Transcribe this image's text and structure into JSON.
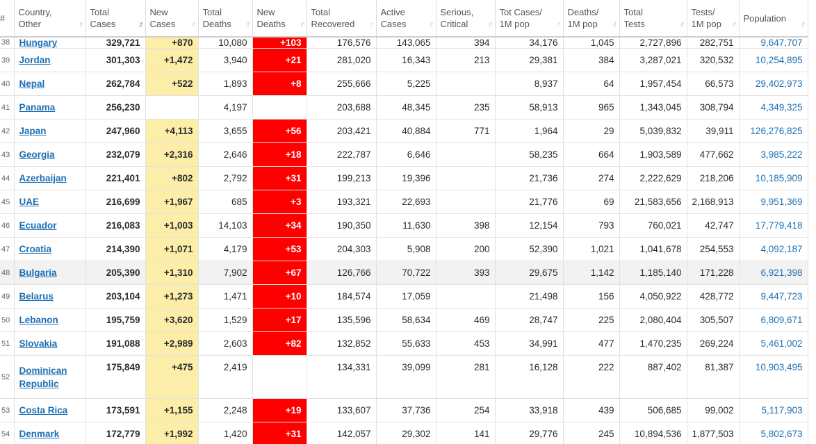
{
  "headers": [
    {
      "label": "#"
    },
    {
      "label": "Country,\nOther"
    },
    {
      "label": "Total\nCases",
      "sorted": true
    },
    {
      "label": "New\nCases"
    },
    {
      "label": "Total\nDeaths"
    },
    {
      "label": "New\nDeaths"
    },
    {
      "label": "Total\nRecovered"
    },
    {
      "label": "Active\nCases"
    },
    {
      "label": "Serious,\nCritical"
    },
    {
      "label": "Tot Cases/\n1M pop"
    },
    {
      "label": "Deaths/\n1M pop"
    },
    {
      "label": "Total\nTests"
    },
    {
      "label": "Tests/\n1M pop"
    },
    {
      "label": "Population"
    }
  ],
  "rows": [
    {
      "num": "38",
      "country": "Hungary",
      "total_cases": "329,721",
      "new_cases": "+870",
      "total_deaths": "10,080",
      "new_deaths": "+103",
      "total_recovered": "176,576",
      "active_cases": "143,065",
      "serious_critical": "394",
      "cases_per_1m": "34,176",
      "deaths_per_1m": "1,045",
      "total_tests": "2,727,896",
      "tests_per_1m": "282,751",
      "population": "9,647,707"
    },
    {
      "num": "39",
      "country": "Jordan",
      "total_cases": "301,303",
      "new_cases": "+1,472",
      "total_deaths": "3,940",
      "new_deaths": "+21",
      "total_recovered": "281,020",
      "active_cases": "16,343",
      "serious_critical": "213",
      "cases_per_1m": "29,381",
      "deaths_per_1m": "384",
      "total_tests": "3,287,021",
      "tests_per_1m": "320,532",
      "population": "10,254,895"
    },
    {
      "num": "40",
      "country": "Nepal",
      "total_cases": "262,784",
      "new_cases": "+522",
      "total_deaths": "1,893",
      "new_deaths": "+8",
      "total_recovered": "255,666",
      "active_cases": "5,225",
      "serious_critical": "",
      "cases_per_1m": "8,937",
      "deaths_per_1m": "64",
      "total_tests": "1,957,454",
      "tests_per_1m": "66,573",
      "population": "29,402,973"
    },
    {
      "num": "41",
      "country": "Panama",
      "total_cases": "256,230",
      "new_cases": "",
      "total_deaths": "4,197",
      "new_deaths": "",
      "total_recovered": "203,688",
      "active_cases": "48,345",
      "serious_critical": "235",
      "cases_per_1m": "58,913",
      "deaths_per_1m": "965",
      "total_tests": "1,343,045",
      "tests_per_1m": "308,794",
      "population": "4,349,325"
    },
    {
      "num": "42",
      "country": "Japan",
      "total_cases": "247,960",
      "new_cases": "+4,113",
      "total_deaths": "3,655",
      "new_deaths": "+56",
      "total_recovered": "203,421",
      "active_cases": "40,884",
      "serious_critical": "771",
      "cases_per_1m": "1,964",
      "deaths_per_1m": "29",
      "total_tests": "5,039,832",
      "tests_per_1m": "39,911",
      "population": "126,276,825"
    },
    {
      "num": "43",
      "country": "Georgia",
      "total_cases": "232,079",
      "new_cases": "+2,316",
      "total_deaths": "2,646",
      "new_deaths": "+18",
      "total_recovered": "222,787",
      "active_cases": "6,646",
      "serious_critical": "",
      "cases_per_1m": "58,235",
      "deaths_per_1m": "664",
      "total_tests": "1,903,589",
      "tests_per_1m": "477,662",
      "population": "3,985,222"
    },
    {
      "num": "44",
      "country": "Azerbaijan",
      "total_cases": "221,401",
      "new_cases": "+802",
      "total_deaths": "2,792",
      "new_deaths": "+31",
      "total_recovered": "199,213",
      "active_cases": "19,396",
      "serious_critical": "",
      "cases_per_1m": "21,736",
      "deaths_per_1m": "274",
      "total_tests": "2,222,629",
      "tests_per_1m": "218,206",
      "population": "10,185,909"
    },
    {
      "num": "45",
      "country": "UAE",
      "total_cases": "216,699",
      "new_cases": "+1,967",
      "total_deaths": "685",
      "new_deaths": "+3",
      "total_recovered": "193,321",
      "active_cases": "22,693",
      "serious_critical": "",
      "cases_per_1m": "21,776",
      "deaths_per_1m": "69",
      "total_tests": "21,583,656",
      "tests_per_1m": "2,168,913",
      "population": "9,951,369"
    },
    {
      "num": "46",
      "country": "Ecuador",
      "total_cases": "216,083",
      "new_cases": "+1,003",
      "total_deaths": "14,103",
      "new_deaths": "+34",
      "total_recovered": "190,350",
      "active_cases": "11,630",
      "serious_critical": "398",
      "cases_per_1m": "12,154",
      "deaths_per_1m": "793",
      "total_tests": "760,021",
      "tests_per_1m": "42,747",
      "population": "17,779,418"
    },
    {
      "num": "47",
      "country": "Croatia",
      "total_cases": "214,390",
      "new_cases": "+1,071",
      "total_deaths": "4,179",
      "new_deaths": "+53",
      "total_recovered": "204,303",
      "active_cases": "5,908",
      "serious_critical": "200",
      "cases_per_1m": "52,390",
      "deaths_per_1m": "1,021",
      "total_tests": "1,041,678",
      "tests_per_1m": "254,553",
      "population": "4,092,187"
    },
    {
      "num": "48",
      "country": "Bulgaria",
      "total_cases": "205,390",
      "new_cases": "+1,310",
      "total_deaths": "7,902",
      "new_deaths": "+67",
      "total_recovered": "126,766",
      "active_cases": "70,722",
      "serious_critical": "393",
      "cases_per_1m": "29,675",
      "deaths_per_1m": "1,142",
      "total_tests": "1,185,140",
      "tests_per_1m": "171,228",
      "population": "6,921,398",
      "highlighted": true
    },
    {
      "num": "49",
      "country": "Belarus",
      "total_cases": "203,104",
      "new_cases": "+1,273",
      "total_deaths": "1,471",
      "new_deaths": "+10",
      "total_recovered": "184,574",
      "active_cases": "17,059",
      "serious_critical": "",
      "cases_per_1m": "21,498",
      "deaths_per_1m": "156",
      "total_tests": "4,050,922",
      "tests_per_1m": "428,772",
      "population": "9,447,723"
    },
    {
      "num": "50",
      "country": "Lebanon",
      "total_cases": "195,759",
      "new_cases": "+3,620",
      "total_deaths": "1,529",
      "new_deaths": "+17",
      "total_recovered": "135,596",
      "active_cases": "58,634",
      "serious_critical": "469",
      "cases_per_1m": "28,747",
      "deaths_per_1m": "225",
      "total_tests": "2,080,404",
      "tests_per_1m": "305,507",
      "population": "6,809,671"
    },
    {
      "num": "51",
      "country": "Slovakia",
      "total_cases": "191,088",
      "new_cases": "+2,989",
      "total_deaths": "2,603",
      "new_deaths": "+82",
      "total_recovered": "132,852",
      "active_cases": "55,633",
      "serious_critical": "453",
      "cases_per_1m": "34,991",
      "deaths_per_1m": "477",
      "total_tests": "1,470,235",
      "tests_per_1m": "269,224",
      "population": "5,461,002"
    },
    {
      "num": "52",
      "country": "Dominican Republic",
      "total_cases": "175,849",
      "new_cases": "+475",
      "total_deaths": "2,419",
      "new_deaths": "",
      "total_recovered": "134,331",
      "active_cases": "39,099",
      "serious_critical": "281",
      "cases_per_1m": "16,128",
      "deaths_per_1m": "222",
      "total_tests": "887,402",
      "tests_per_1m": "81,387",
      "population": "10,903,495",
      "tall": true
    },
    {
      "num": "53",
      "country": "Costa Rica",
      "total_cases": "173,591",
      "new_cases": "+1,155",
      "total_deaths": "2,248",
      "new_deaths": "+19",
      "total_recovered": "133,607",
      "active_cases": "37,736",
      "serious_critical": "254",
      "cases_per_1m": "33,918",
      "deaths_per_1m": "439",
      "total_tests": "506,685",
      "tests_per_1m": "99,002",
      "population": "5,117,903"
    },
    {
      "num": "54",
      "country": "Denmark",
      "total_cases": "172,779",
      "new_cases": "+1,992",
      "total_deaths": "1,420",
      "new_deaths": "+31",
      "total_recovered": "142,057",
      "active_cases": "29,302",
      "serious_critical": "141",
      "cases_per_1m": "29,776",
      "deaths_per_1m": "245",
      "total_tests": "10,894,536",
      "tests_per_1m": "1,877,503",
      "population": "5,802,673"
    }
  ],
  "colors": {
    "link": "#1b6fb5",
    "new_cases_bg": "#fceea8",
    "new_deaths_bg": "#ff0000",
    "highlight_row_bg": "#f2f2f2"
  },
  "icons": {
    "sort": "sort-arrows-icon"
  }
}
